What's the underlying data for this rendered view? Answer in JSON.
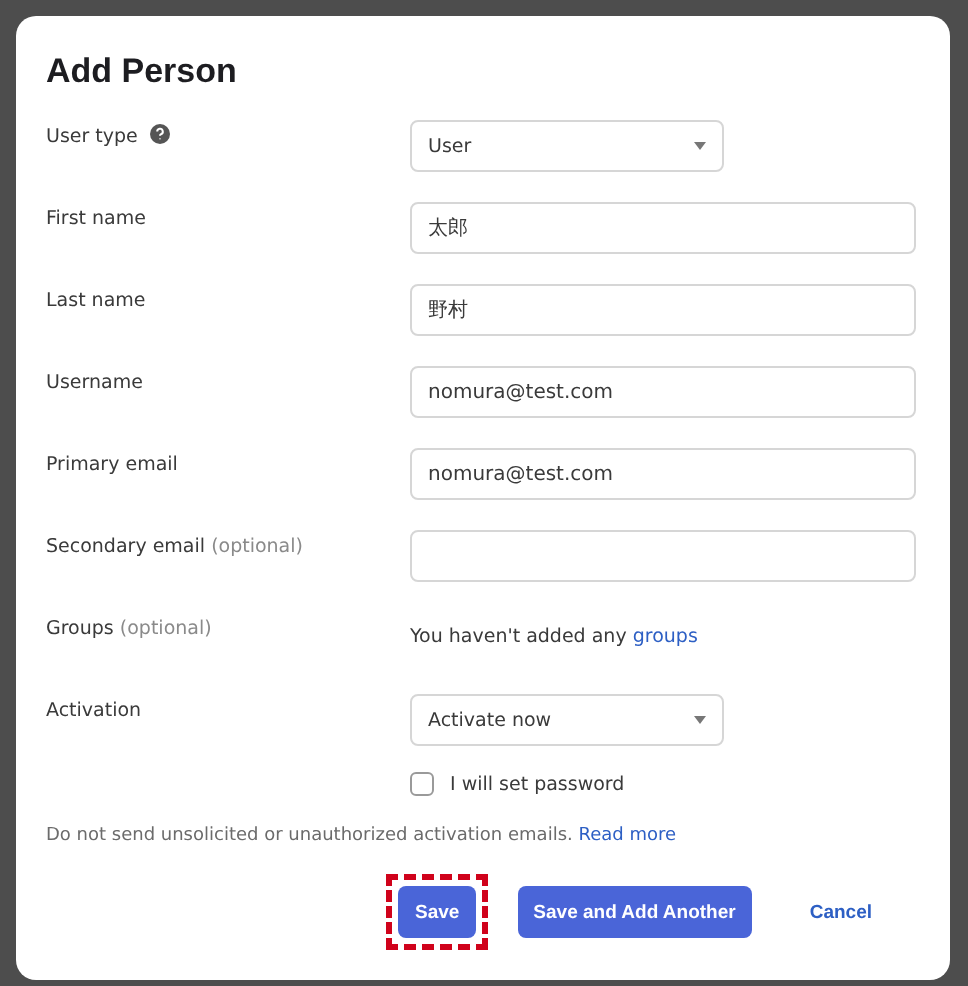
{
  "dialog": {
    "title": "Add Person"
  },
  "fields": [
    {
      "kind": "select",
      "label": "User type",
      "help": true,
      "value": "User"
    },
    {
      "kind": "input",
      "label": "First name",
      "value": "太郎"
    },
    {
      "kind": "input",
      "label": "Last name",
      "value": "野村"
    },
    {
      "kind": "input",
      "label": "Username",
      "value": "nomura@test.com"
    },
    {
      "kind": "input",
      "label": "Primary email",
      "value": "nomura@test.com"
    },
    {
      "kind": "input",
      "label": "Secondary email",
      "note": "(optional)"
    },
    {
      "kind": "text",
      "label": "Groups",
      "note": "(optional)",
      "text": "You haven't added any",
      "link": "groups"
    },
    {
      "kind": "select",
      "label": "Activation",
      "value": "Activate now"
    }
  ],
  "checkbox": {
    "label": "I will set password",
    "checked": false
  },
  "notice": {
    "text": "Do not send unsolicited or unauthorized activation emails.",
    "link": "Read more"
  },
  "buttons": [
    {
      "kind": "primary",
      "label": "Save",
      "highlighted": true
    },
    {
      "kind": "primary",
      "label": "Save and Add Another",
      "highlighted": false
    },
    {
      "kind": "link",
      "label": "Cancel",
      "highlighted": false
    }
  ]
}
